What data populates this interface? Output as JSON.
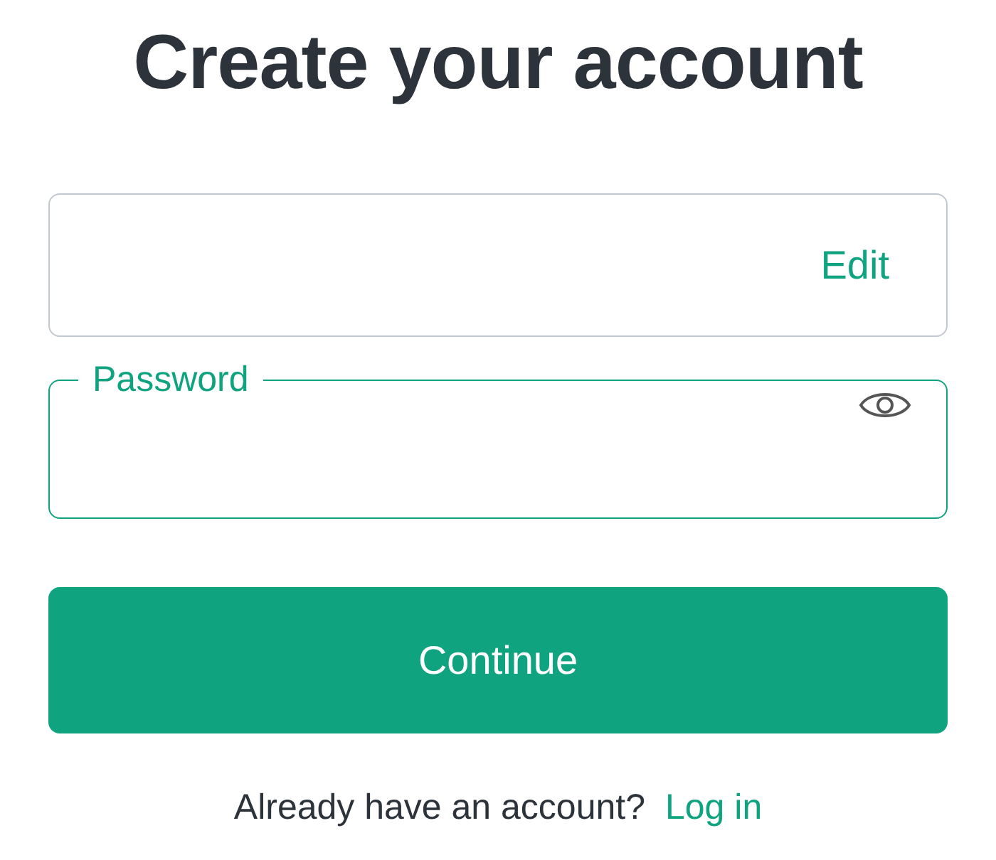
{
  "title": "Create your account",
  "email_field": {
    "action": "Edit"
  },
  "password_field": {
    "label": "Password",
    "focused": true
  },
  "continue_button": "Continue",
  "footer": {
    "text": "Already have an account?",
    "link": "Log in"
  }
}
